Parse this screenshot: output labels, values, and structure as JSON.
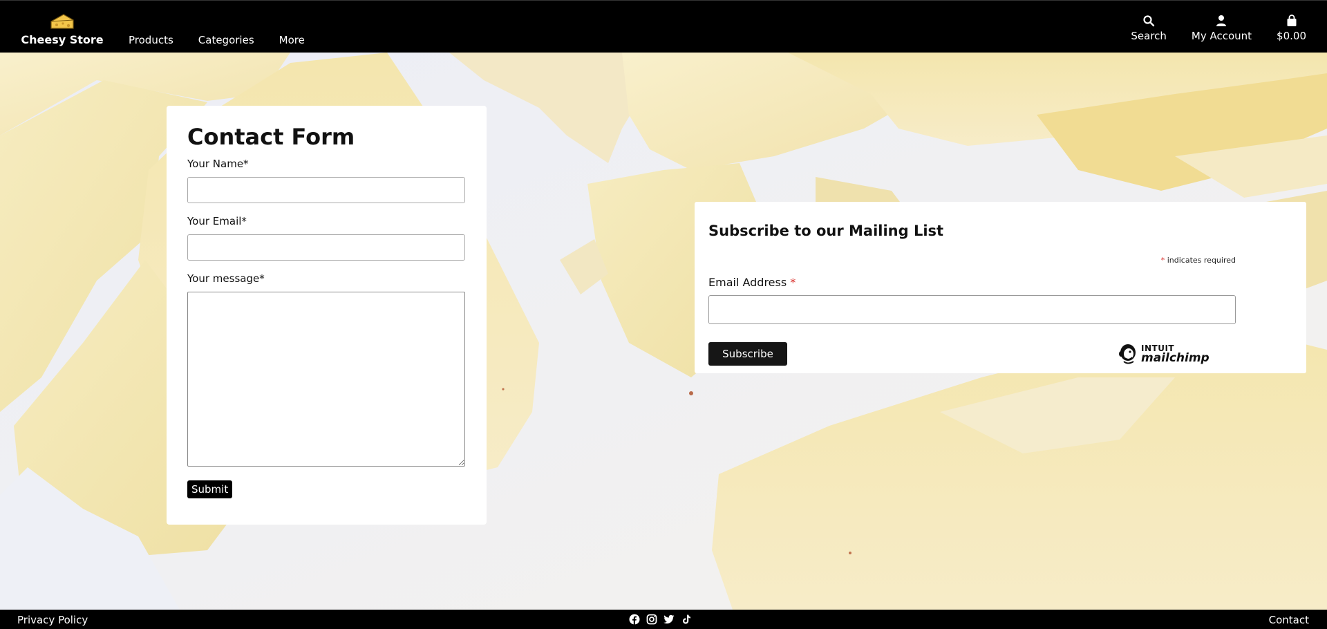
{
  "header": {
    "brand_name": "Cheesy Store",
    "nav": [
      "Products",
      "Categories",
      "More"
    ],
    "search_label": "Search",
    "account_label": "My Account",
    "cart_label": "$0.00"
  },
  "contact": {
    "title": "Contact Form",
    "name_label": "Your Name*",
    "name_value": "",
    "email_label": "Your Email*",
    "email_value": "",
    "message_label": "Your message*",
    "message_value": "",
    "submit_label": "Submit"
  },
  "mailing": {
    "title": "Subscribe to our Mailing List",
    "required_asterisk": "*",
    "required_note": "indicates required",
    "email_label": "Email Address",
    "email_asterisk": "*",
    "email_value": "",
    "subscribe_label": "Subscribe",
    "badge_top": "INTUIT",
    "badge_bottom": "mailchimp"
  },
  "footer": {
    "privacy_label": "Privacy Policy",
    "contact_label": "Contact",
    "social_icons": [
      "facebook-icon",
      "instagram-icon",
      "twitter-icon",
      "tiktok-icon"
    ]
  },
  "colors": {
    "header_bg": "#000000",
    "required_red": "#d9302c",
    "button_black": "#161616"
  }
}
